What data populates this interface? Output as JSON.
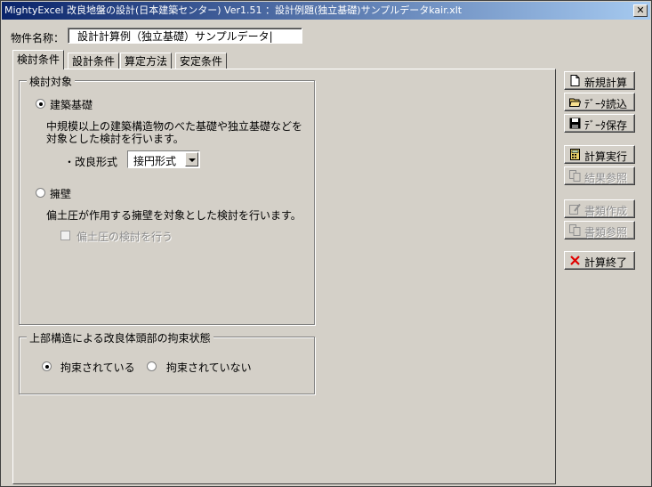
{
  "window": {
    "title": "MightyExcel 改良地盤の設計(日本建築センター) Ver1.51 ：設計例題(独立基礎)サンプルデータkair.xlt",
    "close": "✕"
  },
  "header": {
    "name_label": "物件名称：",
    "name_value": "設計計算例（独立基礎）サンプルデータ|"
  },
  "tabs": [
    {
      "label": "検討条件"
    },
    {
      "label": "設計条件"
    },
    {
      "label": "算定方法"
    },
    {
      "label": "安定条件"
    }
  ],
  "target_group": {
    "title": "検討対象",
    "building": {
      "label": "建築基礎",
      "selected": true,
      "desc1": "中規模以上の建築構造物のべた基礎や独立基礎などを",
      "desc2": "対象とした検討を行います。",
      "improve_label": "・改良形式",
      "improve_value": "接円形式"
    },
    "wall": {
      "label": "擁壁",
      "selected": false,
      "desc": "偏土圧が作用する擁壁を対象とした検討を行います。",
      "check_label": "偏土圧の検討を行う"
    }
  },
  "restraint_group": {
    "title": "上部構造による改良体頭部の拘束状態",
    "opt1": "拘束されている",
    "opt2": "拘束されていない",
    "selected": "opt1"
  },
  "buttons": {
    "new_calc": "新規計算",
    "load_data": "ﾃﾞｰﾀ読込",
    "save_data": "ﾃﾞｰﾀ保存",
    "run_calc": "計算実行",
    "view_result": "結果参照",
    "make_doc": "書類作成",
    "view_doc": "書類参照",
    "exit_calc": "計算終了"
  },
  "icons": {
    "new": "new-document-icon",
    "open": "folder-open-icon",
    "save": "floppy-disk-icon",
    "run": "calculator-icon",
    "result": "copy-documents-icon",
    "doc": "pencil-document-icon",
    "docview": "copy-documents-icon",
    "exit": "red-x-icon"
  }
}
